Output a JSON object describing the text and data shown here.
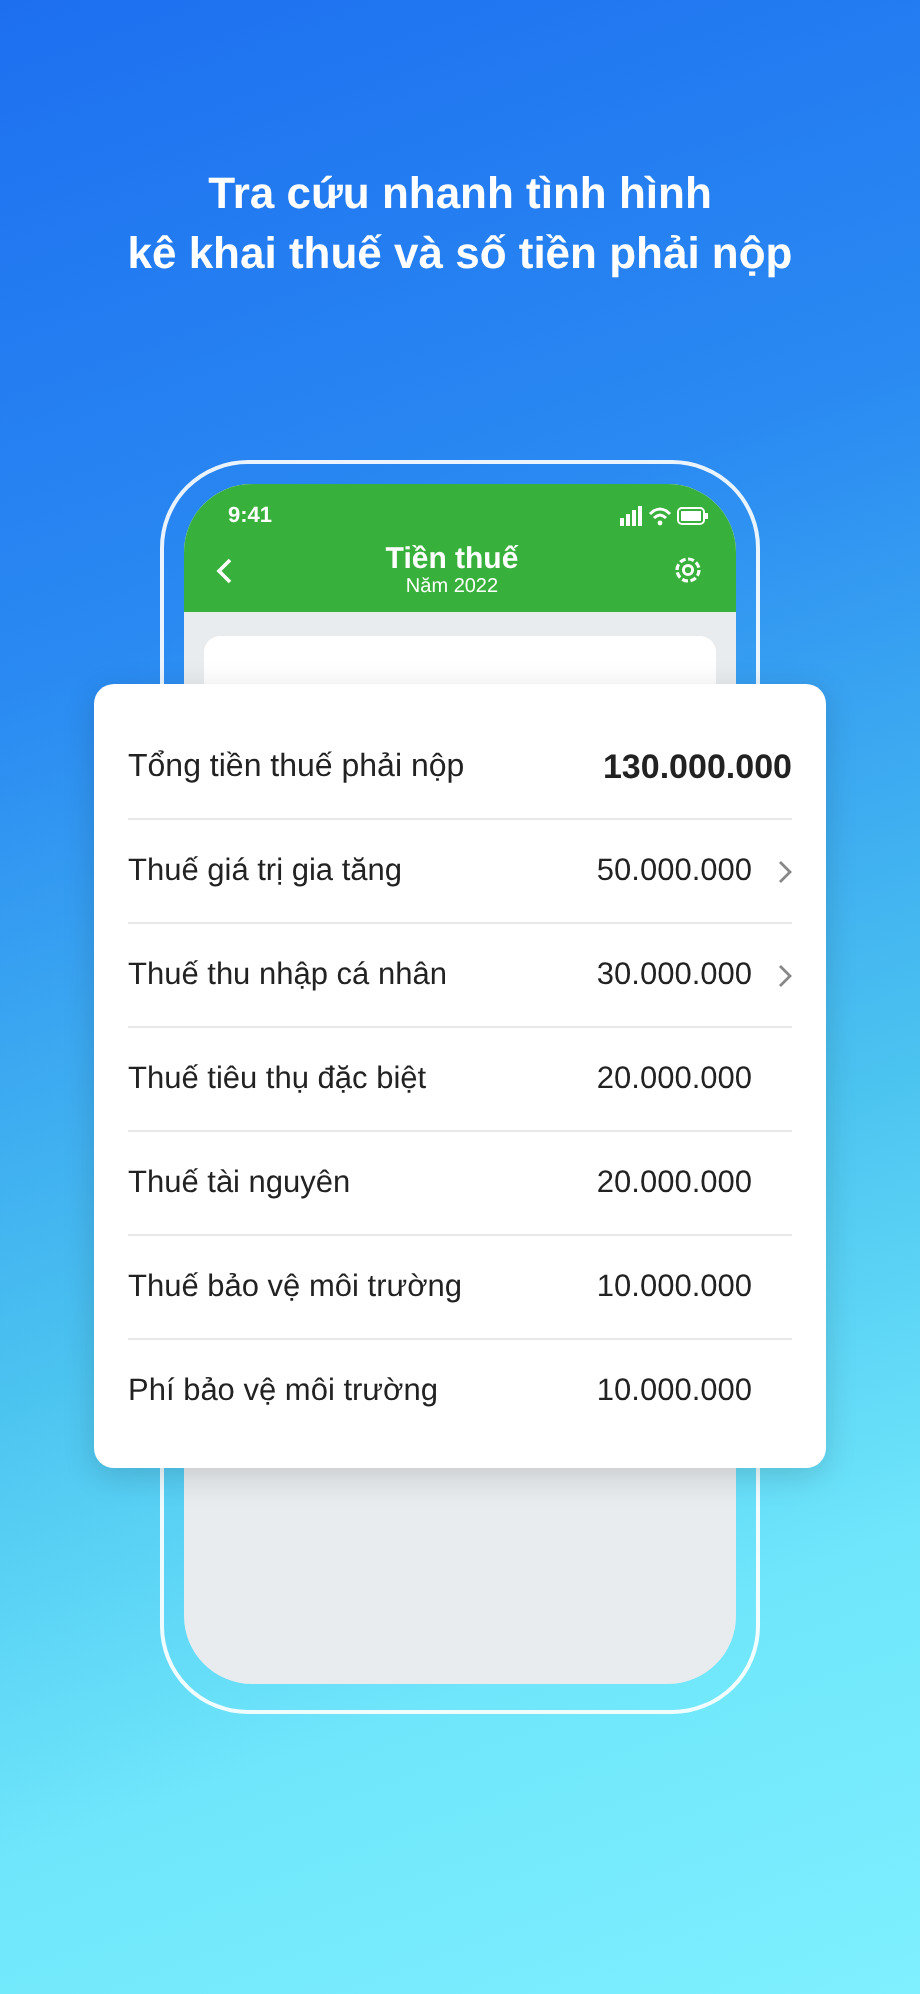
{
  "headline": [
    "Tra cứu nhanh tình hình",
    "kê khai thuế và số tiền phải nộp"
  ],
  "status_bar": {
    "time": "9:41"
  },
  "header": {
    "title": "Tiền thuế",
    "subtitle": "Năm 2022"
  },
  "tax_rows": [
    {
      "kind": "total",
      "label": "Tổng tiền thuế phải nộp",
      "amount": "130.000.000",
      "chevron": false
    },
    {
      "kind": "item",
      "label": "Thuế giá trị gia tăng",
      "amount": "50.000.000",
      "chevron": true
    },
    {
      "kind": "item",
      "label": "Thuế thu nhập cá nhân",
      "amount": "30.000.000",
      "chevron": true
    },
    {
      "kind": "item",
      "label": "Thuế tiêu thụ đặc biệt",
      "amount": "20.000.000",
      "chevron": false
    },
    {
      "kind": "item",
      "label": "Thuế tài nguyên",
      "amount": "20.000.000",
      "chevron": false
    },
    {
      "kind": "item",
      "label": "Thuế bảo vệ môi trường",
      "amount": "10.000.000",
      "chevron": false
    },
    {
      "kind": "item",
      "label": "Phí bảo vệ môi trường",
      "amount": "10.000.000",
      "chevron": false
    }
  ]
}
